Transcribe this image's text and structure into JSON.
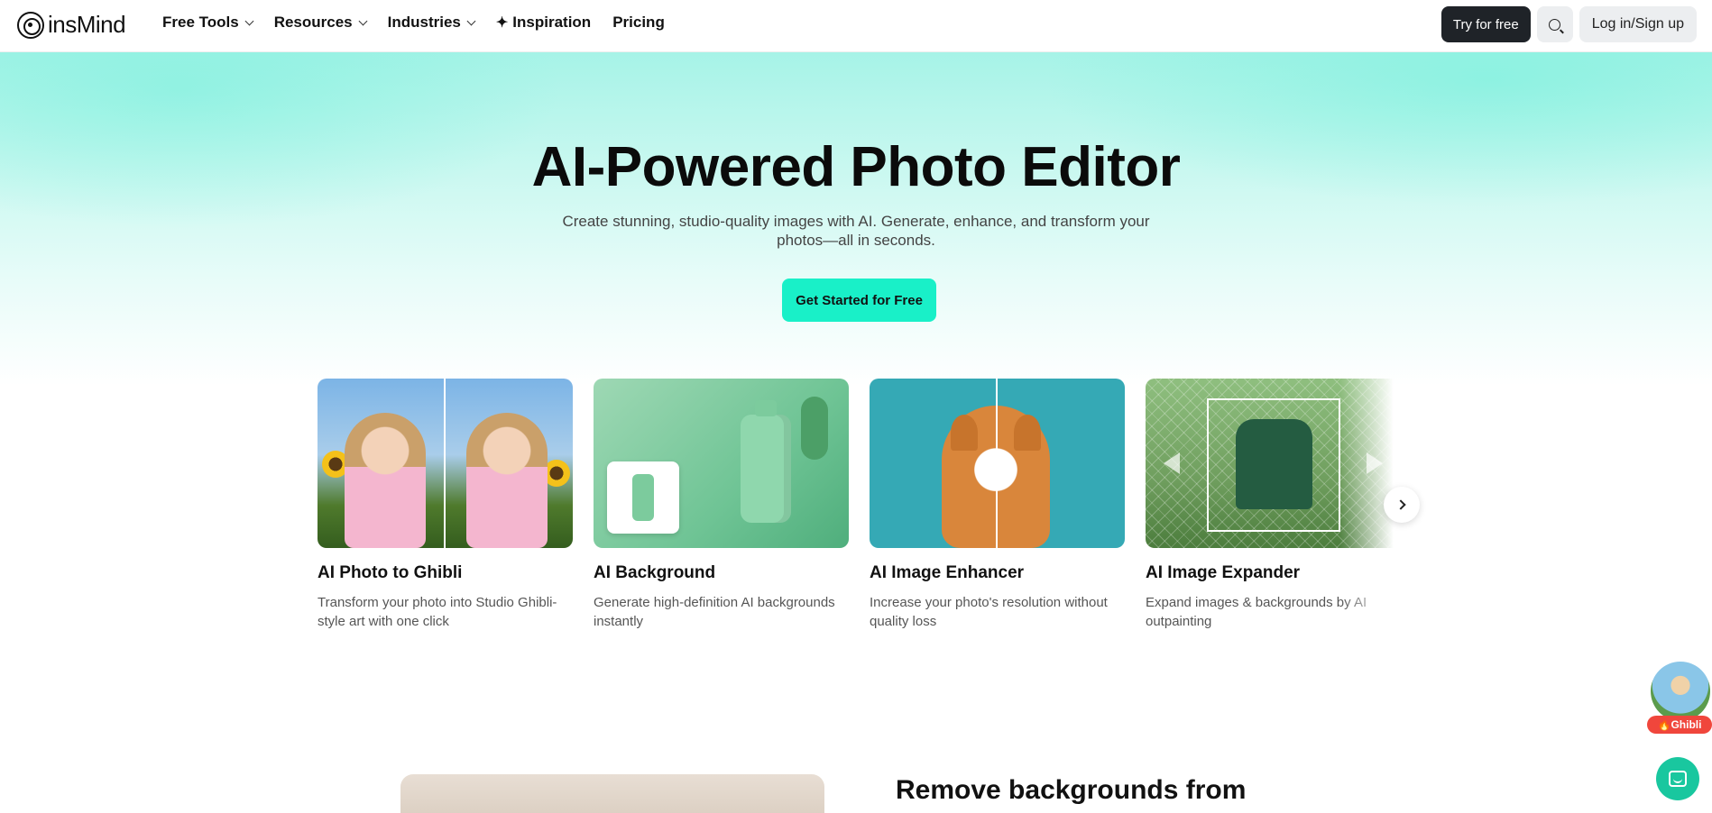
{
  "header": {
    "logo_text": "insMind",
    "nav": [
      {
        "label": "Free Tools",
        "icon": "chevron-down-icon"
      },
      {
        "label": "Resources",
        "icon": "chevron-down-icon"
      },
      {
        "label": "Industries",
        "icon": "chevron-down-icon"
      },
      {
        "label": "Inspiration",
        "icon": "sparkle-icon"
      },
      {
        "label": "Pricing"
      }
    ],
    "try_label": "Try for free",
    "login_label": "Log in/Sign up"
  },
  "hero": {
    "title": "AI-Powered Photo Editor",
    "subtitle": "Create stunning, studio-quality images with AI. Generate, enhance, and transform your photos—all in seconds.",
    "cta": "Get Started for Free"
  },
  "cards": [
    {
      "title": "AI Photo to Ghibli",
      "desc": "Transform your photo into Studio Ghibli-style art with one click"
    },
    {
      "title": "AI Background",
      "desc": "Generate high-definition AI backgrounds instantly"
    },
    {
      "title": "AI Image Enhancer",
      "desc": "Increase your photo's resolution without quality loss"
    },
    {
      "title": "AI Image Expander",
      "desc": "Expand images & backgrounds by AI outpainting"
    }
  ],
  "bottom": {
    "title": "Remove backgrounds from"
  },
  "float": {
    "ghibli_label": "Ghibli",
    "ghibli_icon": "flame-icon"
  },
  "colors": {
    "accent": "#19f0c8",
    "dark_button": "#1f2328",
    "chat": "#19c79f"
  }
}
